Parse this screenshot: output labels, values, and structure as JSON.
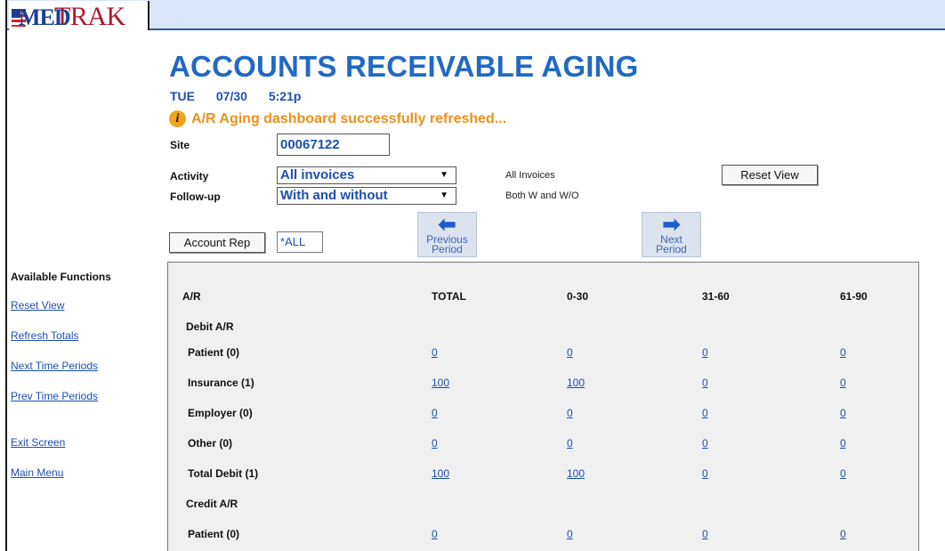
{
  "header": {
    "logo_text": "TRAK",
    "logo_mark": "MED"
  },
  "page": {
    "title": "ACCOUNTS RECEIVABLE AGING",
    "day": "TUE",
    "date": "07/30",
    "time": "5:21p",
    "message": "A/R Aging dashboard successfully refreshed..."
  },
  "form": {
    "site_label": "Site",
    "site_value": "00067122",
    "activity_label": "Activity",
    "activity_value": "All invoices",
    "activity_hint": "All Invoices",
    "followup_label": "Follow-up",
    "followup_value": "With and without",
    "followup_hint": "Both W and W/O",
    "reset_view": "Reset View",
    "account_rep": "Account Rep",
    "account_rep_value": "*ALL",
    "prev_period_1": "Previous",
    "prev_period_2": "Period",
    "next_period_1": "Next",
    "next_period_2": "Period"
  },
  "sidebar": {
    "title": "Available Functions",
    "links": [
      "Reset View",
      "Refresh Totals",
      "Next Time Periods",
      "Prev Time Periods",
      "Exit Screen",
      "Main Menu"
    ]
  },
  "table": {
    "headers": [
      "A/R",
      "TOTAL",
      "0-30",
      "31-60",
      "61-90"
    ],
    "debit_label": "Debit A/R",
    "credit_label": "Credit A/R",
    "debit_rows": [
      {
        "label": "Patient (0)",
        "values": [
          "0",
          "0",
          "0",
          "0"
        ]
      },
      {
        "label": "Insurance (1)",
        "values": [
          "100",
          "100",
          "0",
          "0"
        ]
      },
      {
        "label": "Employer (0)",
        "values": [
          "0",
          "0",
          "0",
          "0"
        ]
      },
      {
        "label": "Other (0)",
        "values": [
          "0",
          "0",
          "0",
          "0"
        ]
      },
      {
        "label": "Total Debit (1)",
        "values": [
          "100",
          "100",
          "0",
          "0"
        ]
      }
    ],
    "credit_rows": [
      {
        "label": "Patient (0)",
        "values": [
          "0",
          "0",
          "0",
          "0"
        ]
      }
    ]
  }
}
